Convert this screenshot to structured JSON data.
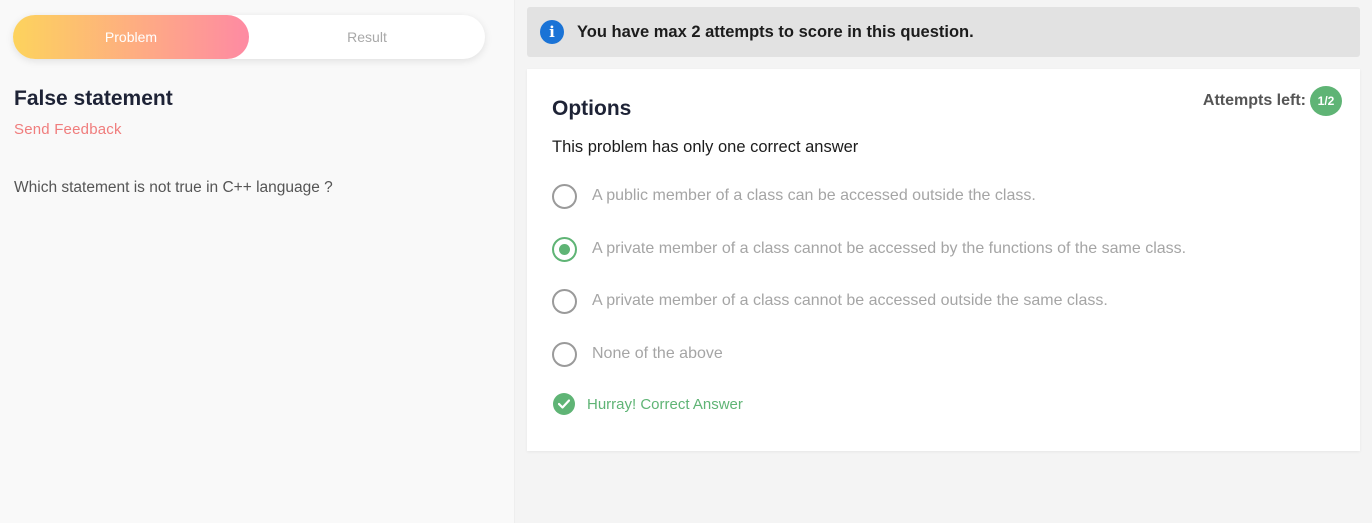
{
  "tabs": [
    {
      "label": "Problem",
      "active": true
    },
    {
      "label": "Result",
      "active": false
    }
  ],
  "problem": {
    "title": "False statement",
    "feedback_label": "Send Feedback",
    "question": "Which statement is not true in C++ language ?"
  },
  "banner": {
    "icon": "info-icon",
    "text": "You have max 2 attempts to score in this question."
  },
  "options_panel": {
    "title": "Options",
    "attempts_label": "Attempts left:",
    "attempts_value": "1/2",
    "instruction": "This problem has only one correct answer",
    "options": [
      {
        "label": "A public member of a class can be accessed outside the class.",
        "selected": false
      },
      {
        "label": "A private member of a class cannot be accessed by the functions of the same class.",
        "selected": true
      },
      {
        "label": "A private member of a class cannot be accessed outside the same class.",
        "selected": false
      },
      {
        "label": "None of the above",
        "selected": false
      }
    ],
    "result_text": "Hurray! Correct Answer"
  },
  "colors": {
    "accent_green": "#5fb475",
    "gradient_start": "#fdd35d",
    "gradient_end": "#fe8aa3",
    "link": "#f07d7d",
    "info_blue": "#1a73d6"
  }
}
